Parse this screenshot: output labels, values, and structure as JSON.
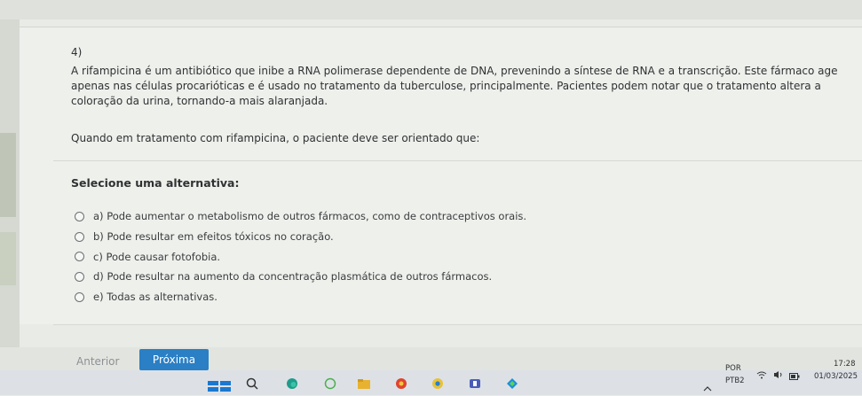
{
  "question": {
    "number": "4)",
    "paragraph": "A rifampicina é um antibiótico que inibe a RNA polimerase dependente de DNA, prevenindo a síntese de RNA e a transcrição. Este fármaco age apenas nas células procarióticas e é usado no tratamento da tuberculose, principalmente. Pacientes podem notar que o tratamento altera a coloração da urina, tornando-a mais alaranjada.",
    "prompt": "Quando em tratamento com rifampicina, o paciente deve ser orientado que:",
    "select_label": "Selecione uma alternativa:",
    "options": [
      "a) Pode aumentar o metabolismo de outros fármacos, como de contraceptivos orais.",
      "b) Pode resultar em efeitos tóxicos no coração.",
      "c) Pode causar fotofobia.",
      "d) Pode resultar na aumento da concentração plasmática de outros fármacos.",
      "e) Todas as alternativas."
    ]
  },
  "nav": {
    "prev_label": "Anterior",
    "next_label": "Próxima"
  },
  "taskbar": {
    "lang_top": "POR",
    "lang_bottom": "PTB2",
    "time": "17:28",
    "date": "01/03/2025"
  },
  "colors": {
    "accent": "#2b7fc4",
    "background": "#eef0ec"
  }
}
